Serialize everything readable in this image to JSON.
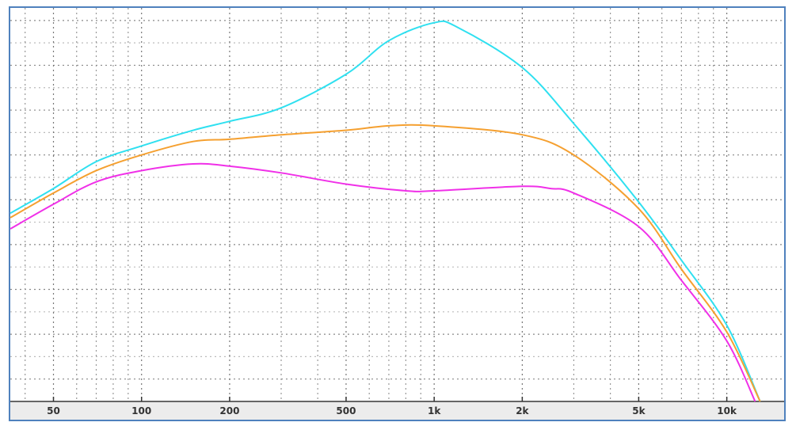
{
  "chart_data": {
    "type": "line",
    "title": "",
    "xlabel": "",
    "ylabel": "",
    "xscale": "log",
    "xlim": [
      35.6,
      15700
    ],
    "ylim": [
      0,
      17.56
    ],
    "grid": true,
    "x_ticks": [
      {
        "value": 50,
        "label": "50"
      },
      {
        "value": 100,
        "label": "100"
      },
      {
        "value": 200,
        "label": "200"
      },
      {
        "value": 500,
        "label": "500"
      },
      {
        "value": 1000,
        "label": "1k"
      },
      {
        "value": 2000,
        "label": "2k"
      },
      {
        "value": 5000,
        "label": "5k"
      },
      {
        "value": 10000,
        "label": "10k"
      }
    ],
    "series": [
      {
        "name": "cyan",
        "color": "#2fe0f0",
        "x": [
          35.6,
          50,
          70,
          100,
          150,
          200,
          300,
          500,
          700,
          1000,
          1200,
          2000,
          3000,
          5000,
          7000,
          10000,
          13000
        ],
        "y": [
          8.4,
          9.5,
          10.7,
          11.4,
          12.1,
          12.5,
          13.1,
          14.6,
          16.1,
          16.9,
          16.7,
          14.9,
          12.4,
          8.9,
          6.3,
          3.4,
          0
        ]
      },
      {
        "name": "orange",
        "color": "#f5a030",
        "x": [
          35.6,
          50,
          70,
          100,
          150,
          200,
          300,
          500,
          700,
          1000,
          2000,
          3000,
          5000,
          7000,
          10000,
          13000
        ],
        "y": [
          8.2,
          9.3,
          10.3,
          11.0,
          11.6,
          11.7,
          11.9,
          12.1,
          12.3,
          12.3,
          11.9,
          11.0,
          8.6,
          5.9,
          3.1,
          0
        ]
      },
      {
        "name": "magenta",
        "color": "#f030e8",
        "x": [
          35.6,
          50,
          70,
          100,
          150,
          200,
          300,
          500,
          800,
          1000,
          2000,
          2500,
          3000,
          5000,
          7000,
          10000,
          12500
        ],
        "y": [
          7.7,
          8.8,
          9.8,
          10.3,
          10.6,
          10.5,
          10.2,
          9.7,
          9.4,
          9.4,
          9.6,
          9.5,
          9.3,
          7.8,
          5.4,
          2.7,
          0
        ]
      }
    ]
  }
}
